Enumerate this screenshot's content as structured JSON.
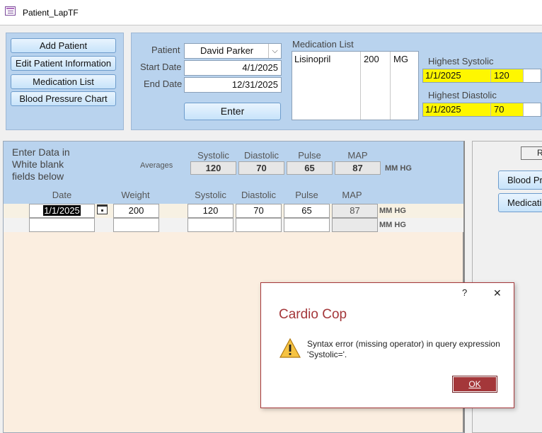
{
  "window": {
    "title": "Patient_LapTF"
  },
  "left_buttons": [
    {
      "label": "Add Patient"
    },
    {
      "label": "Edit Patient Information"
    },
    {
      "label": "Medication List"
    },
    {
      "label": "Blood Pressure Chart"
    }
  ],
  "filter": {
    "patient_label": "Patient",
    "patient_value": "David Parker",
    "start_label": "Start Date",
    "start_value": "4/1/2025",
    "end_label": "End Date",
    "end_value": "12/31/2025",
    "enter_label": "Enter"
  },
  "medication": {
    "title": "Medication List",
    "rows": [
      {
        "name": "Lisinopril",
        "dose": "200",
        "unit": "MG"
      }
    ]
  },
  "highest": {
    "systolic_label": "Highest Systolic",
    "systolic_date": "1/1/2025",
    "systolic_value": "120",
    "diastolic_label": "Highest Diastolic",
    "diastolic_date": "1/1/2025",
    "diastolic_value": "70"
  },
  "entry": {
    "instructions": "Enter Data in White blank fields below",
    "averages_label": "Averages",
    "avg_headers": [
      "Systolic",
      "Diastolic",
      "Pulse",
      "MAP"
    ],
    "averages": {
      "systolic": "120",
      "diastolic": "70",
      "pulse": "65",
      "map": "87",
      "unit": "MM HG"
    },
    "columns": [
      "Date",
      "Weight",
      "Systolic",
      "Diastolic",
      "Pulse",
      "MAP"
    ],
    "rows": [
      {
        "date": "1/1/2025",
        "weight": "200",
        "systolic": "120",
        "diastolic": "70",
        "pulse": "65",
        "map": "87",
        "unit": "MM HG"
      },
      {
        "date": "",
        "weight": "",
        "systolic": "",
        "diastolic": "",
        "pulse": "",
        "map": "",
        "unit": "MM HG"
      }
    ]
  },
  "right_panel": {
    "top_button": "R",
    "buttons": [
      "Blood Pr",
      "Medicati"
    ]
  },
  "dialog": {
    "help": "?",
    "close": "✕",
    "title": "Cardio Cop",
    "message": "Syntax error (missing operator) in query expression 'Systolic='.",
    "ok_label": "OK"
  },
  "colors": {
    "dialog_accent": "#a4373a",
    "highlight": "#fff700",
    "panel_blue": "#b9d3ee",
    "data_bg": "#fbeee0"
  }
}
